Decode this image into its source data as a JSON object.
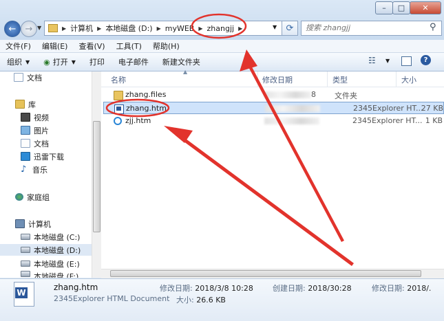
{
  "window": {
    "min_glyph": "–",
    "max_glyph": "□",
    "close_glyph": "✕"
  },
  "address": {
    "crumbs": [
      "计算机",
      "本地磁盘 (D:)",
      "myWEB",
      "zhangjj"
    ]
  },
  "search": {
    "placeholder": "搜索 zhangjj"
  },
  "menu": [
    "文件(F)",
    "编辑(E)",
    "查看(V)",
    "工具(T)",
    "帮助(H)"
  ],
  "toolbar": {
    "organize": "组织",
    "open": "打开",
    "print": "打印",
    "email": "电子邮件",
    "new_folder": "新建文件夹"
  },
  "nav": {
    "docs_top": "文档",
    "library": "库",
    "videos": "视频",
    "pictures": "图片",
    "docs": "文档",
    "downloads": "迅雷下载",
    "music": "音乐",
    "homegroup": "家庭组",
    "computer": "计算机",
    "drive_c": "本地磁盘 (C:)",
    "drive_d": "本地磁盘 (D:)",
    "drive_e": "本地磁盘 (E:)",
    "drive_f": "本地磁盘 (F:)"
  },
  "columns": {
    "name": "名称",
    "date": "修改日期",
    "type": "类型",
    "size": "大小"
  },
  "files": [
    {
      "name": "zhang.files",
      "date_fragment": "8",
      "type": "文件夹",
      "size": ""
    },
    {
      "name": "zhang.htm",
      "date_fragment": "",
      "type": "2345Explorer HT...",
      "size": "27 KB"
    },
    {
      "name": "zjj.htm",
      "date_fragment": "",
      "type": "2345Explorer HT...",
      "size": "1 KB"
    }
  ],
  "details": {
    "filename": "zhang.htm",
    "filetype": "2345Explorer HTML Document",
    "modified_label": "修改日期:",
    "modified_value": "2018/3/8 10:28",
    "created_label": "创建日期:",
    "created_value": "2018/30:28",
    "size_label": "大小:",
    "size_value": "26.6 KB",
    "modified2_label": "修改日期:",
    "modified2_value": "2018/."
  },
  "colors": {
    "annotation": "#e2332c",
    "selection": "#cfe3fb",
    "accent": "#2b579a"
  }
}
